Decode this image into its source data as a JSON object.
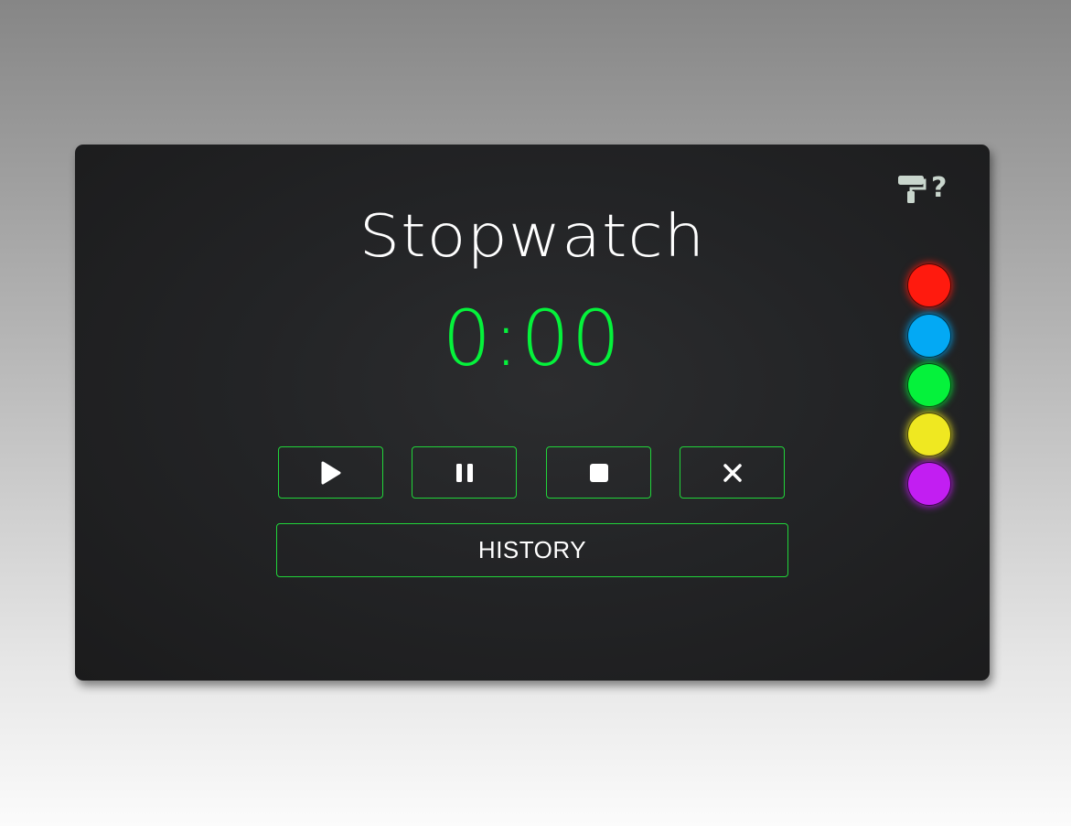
{
  "app": {
    "title": "Stopwatch",
    "time": "0:00"
  },
  "controls": {
    "play_icon": "play-icon",
    "pause_icon": "pause-icon",
    "stop_icon": "stop-icon",
    "reset_icon": "close-icon",
    "history_label": "HISTORY"
  },
  "tools": {
    "theme_icon": "paint-roller-icon",
    "help_label": "?"
  },
  "themes": [
    {
      "name": "red",
      "color": "#ff1a0e"
    },
    {
      "name": "blue",
      "color": "#03a9f4"
    },
    {
      "name": "green",
      "color": "#05f23b"
    },
    {
      "name": "yellow",
      "color": "#efe821"
    },
    {
      "name": "purple",
      "color": "#c21ef2"
    }
  ],
  "colors": {
    "accent": "#05f23b",
    "border": "#21d53a",
    "card": "#232426",
    "text": "#ffffff",
    "icon": "#c9d6cd"
  }
}
